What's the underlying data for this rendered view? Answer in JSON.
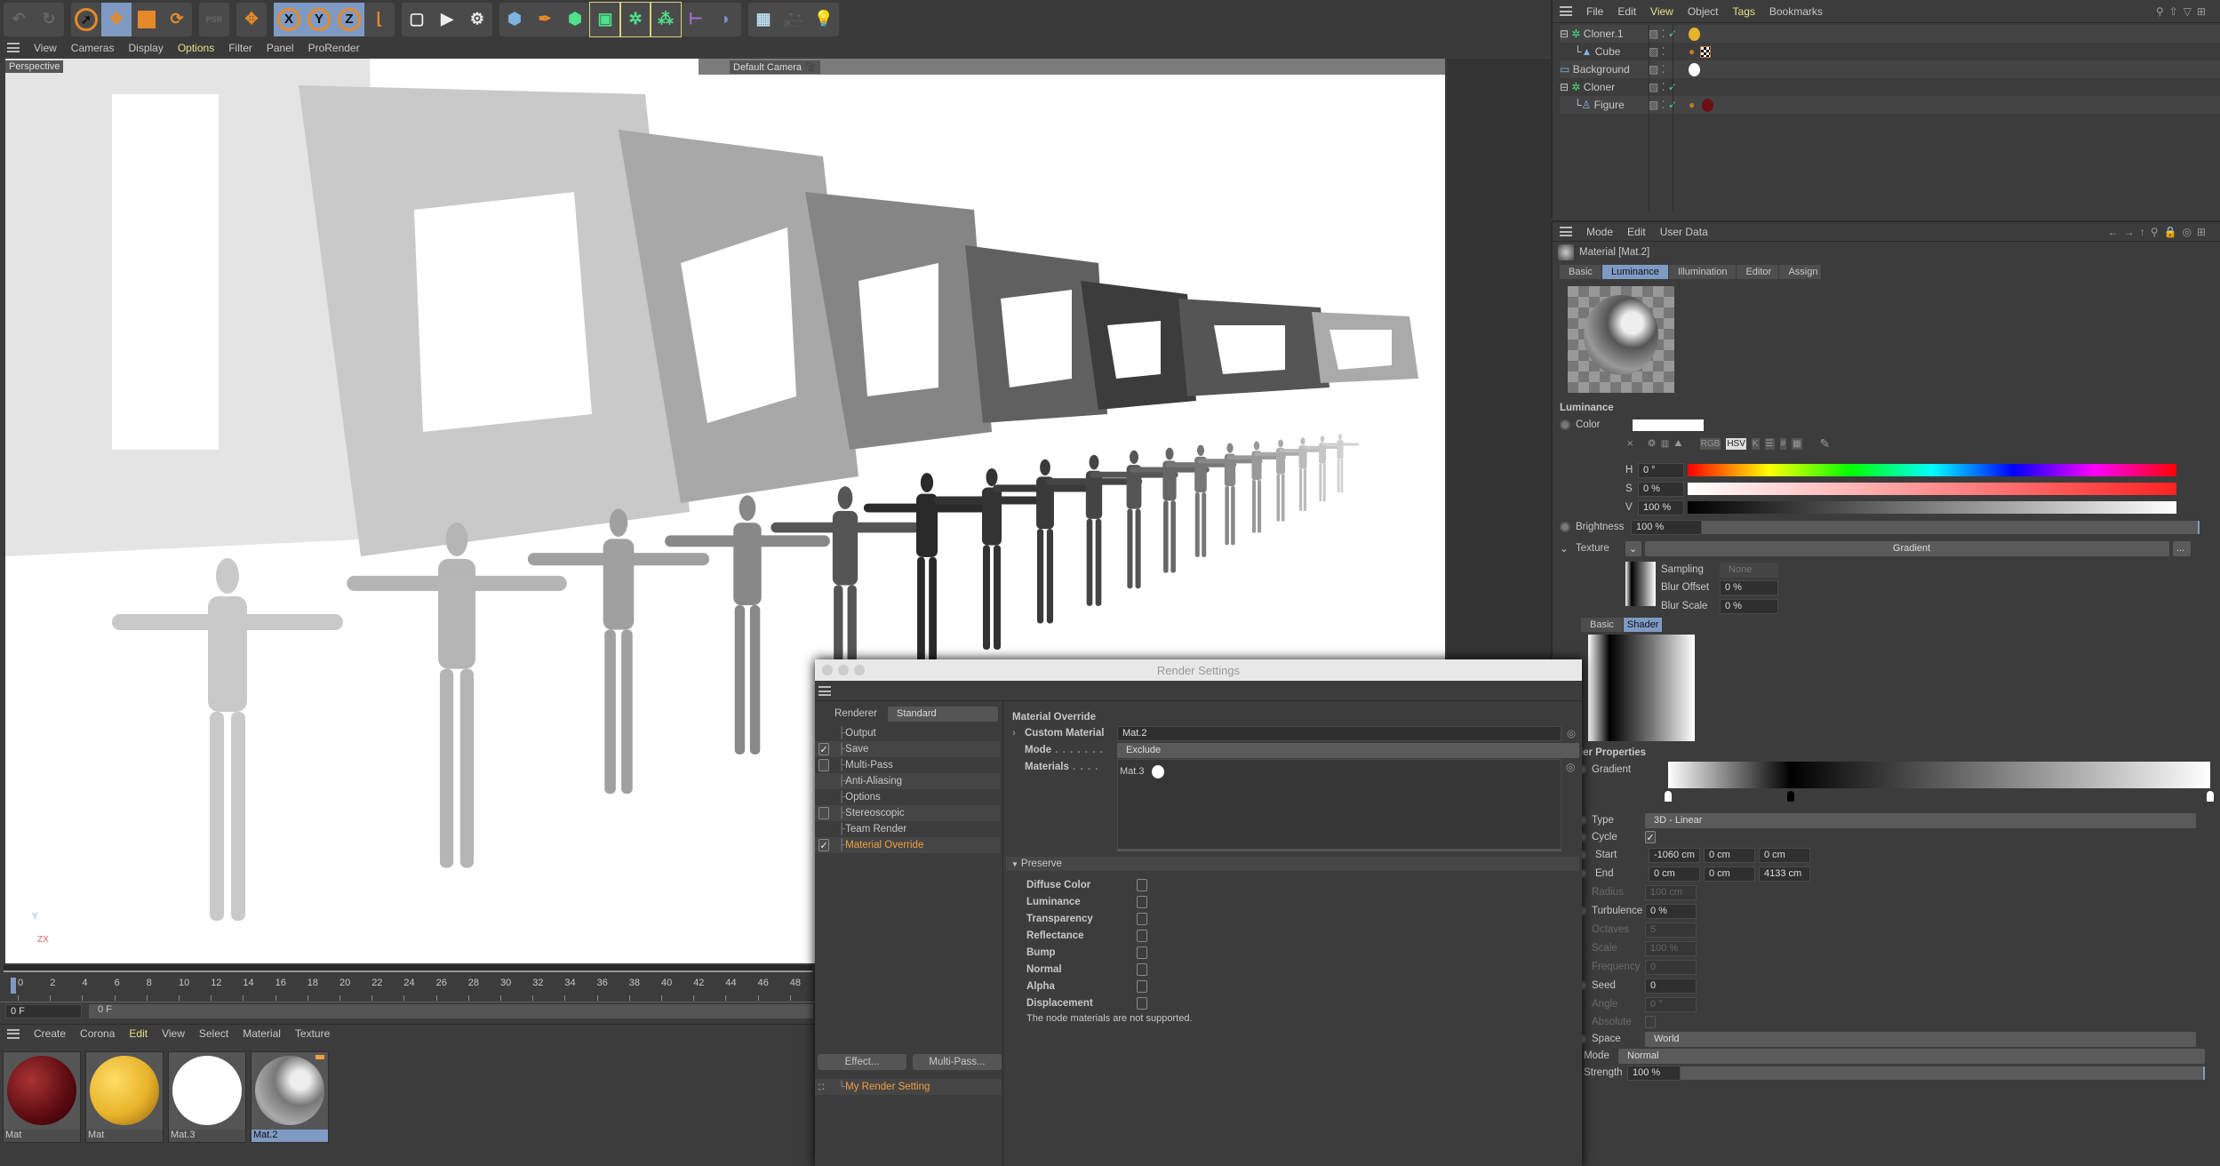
{
  "toolbar": {
    "icons": [
      "undo-icon",
      "redo-icon",
      "live-selection-icon",
      "move-icon",
      "scale-icon",
      "rotate-icon",
      "psr-icon",
      "axis-move-icon",
      "x-axis-lock",
      "y-axis-lock",
      "z-axis-lock",
      "coordinate-system-icon",
      "render-view-icon",
      "render-picture-viewer-icon",
      "render-settings-icon",
      "cube-icon",
      "pen-icon",
      "subdivision-surface-icon",
      "cloner-icon",
      "mograph-icon",
      "voronoi-icon",
      "deformer-icon",
      "field-icon",
      "floor-icon",
      "camera-icon",
      "light-icon"
    ],
    "axis_labels": [
      "X",
      "Y",
      "Z"
    ],
    "psr_label": "PSR"
  },
  "viewport": {
    "menu": [
      "View",
      "Cameras",
      "Display",
      "Options",
      "Filter",
      "Panel",
      "ProRender"
    ],
    "active_menu": "Options",
    "view_name": "Perspective",
    "camera_name": "Default Camera",
    "axis_y": "Y",
    "axis_zx": "ZX"
  },
  "timeline": {
    "ticks": [
      "0",
      "2",
      "4",
      "6",
      "8",
      "10",
      "12",
      "14",
      "16",
      "18",
      "20",
      "22",
      "24",
      "26",
      "28",
      "30",
      "32",
      "34",
      "36",
      "38",
      "40",
      "42",
      "44",
      "46",
      "48"
    ],
    "current_frame": "0 F",
    "end_frame": "0 F"
  },
  "material_manager": {
    "menu": [
      "Create",
      "Corona",
      "Edit",
      "View",
      "Select",
      "Material",
      "Texture"
    ],
    "materials": [
      {
        "name": "Mat",
        "color": "#7a1a1e",
        "selected": false
      },
      {
        "name": "Mat",
        "color": "#e8b32a",
        "selected": false
      },
      {
        "name": "Mat.3",
        "color": "#ffffff",
        "selected": false
      },
      {
        "name": "Mat.2",
        "color": "#9a9a9a",
        "selected": true
      }
    ]
  },
  "object_manager": {
    "menu": [
      "File",
      "Edit",
      "View",
      "Object",
      "Tags",
      "Bookmarks"
    ],
    "objects": [
      {
        "name": "Cloner.1",
        "indent": 0,
        "icon": "cloner-icon",
        "check": true,
        "tags": [
          "material-tag-yellow"
        ]
      },
      {
        "name": "Cube",
        "indent": 1,
        "icon": "cube-icon",
        "check": false,
        "tags": [
          "phong-tag",
          "checker-material-tag"
        ]
      },
      {
        "name": "Background",
        "indent": 0,
        "icon": "background-icon",
        "check": false,
        "tags": [
          "material-tag-white"
        ]
      },
      {
        "name": "Cloner",
        "indent": 0,
        "icon": "cloner-icon",
        "check": true,
        "tags": []
      },
      {
        "name": "Figure",
        "indent": 1,
        "icon": "figure-icon",
        "check": true,
        "tags": [
          "phong-tag",
          "material-tag-red"
        ]
      }
    ]
  },
  "attributes": {
    "menu": [
      "Mode",
      "Edit",
      "User Data"
    ],
    "title": "Material [Mat.2]",
    "tabs": [
      "Basic",
      "Luminance",
      "Illumination",
      "Editor",
      "Assign"
    ],
    "active_tab": "Luminance",
    "section": "Luminance",
    "color_label": "Color",
    "color_value": "#ffffff",
    "color_modes": [
      "RGB",
      "HSV",
      "K",
      "#"
    ],
    "h_label": "H",
    "h_value": "0 °",
    "s_label": "S",
    "s_value": "0 %",
    "v_label": "V",
    "v_value": "100 %",
    "brightness_label": "Brightness",
    "brightness_value": "100 %",
    "brightness_level": 1.0,
    "texture_label": "Texture",
    "texture_value": "Gradient",
    "texture_more": "...",
    "sampling_label": "Sampling",
    "sampling_value": "None",
    "blur_offset_label": "Blur Offset",
    "blur_offset_value": "0 %",
    "blur_scale_label": "Blur Scale",
    "blur_scale_value": "0 %",
    "sub_tabs": [
      "Basic",
      "Shader"
    ],
    "active_sub_tab": "Shader",
    "shader_heading": "Shader Properties",
    "gradient_label": "Gradient",
    "gradient_stops": [
      {
        "pos": 0,
        "color": "#ffffff"
      },
      {
        "pos": 0.226,
        "color": "#000000"
      },
      {
        "pos": 1,
        "color": "#ffffff"
      }
    ],
    "type_label": "Type",
    "type_value": "3D - Linear",
    "cycle_label": "Cycle",
    "cycle_checked": true,
    "start_label": "Start",
    "start_values": [
      "-1060 cm",
      "0 cm",
      "0 cm"
    ],
    "end_label": "End",
    "end_values": [
      "0 cm",
      "0 cm",
      "4133 cm"
    ],
    "radius_label": "Radius",
    "radius_value": "100 cm",
    "turbulence_label": "Turbulence",
    "turbulence_value": "0 %",
    "octaves_label": "Octaves",
    "octaves_value": "5",
    "scale_label": "Scale",
    "scale_value": "100 %",
    "frequency_label": "Frequency",
    "frequency_value": "0",
    "seed_label": "Seed",
    "seed_value": "0",
    "angle_label": "Angle",
    "angle_value": "0 °",
    "absolute_label": "Absolute",
    "absolute_checked": false,
    "space_label": "Space",
    "space_value": "World",
    "mix_mode_label": "Mix Mode",
    "mix_mode_value": "Normal",
    "mix_strength_label": "Mix Strength",
    "mix_strength_value": "100 %"
  },
  "render_settings": {
    "title": "Render Settings",
    "renderer_label": "Renderer",
    "renderer_value": "Standard",
    "items": [
      {
        "label": "Output",
        "checkbox": null
      },
      {
        "label": "Save",
        "checkbox": true
      },
      {
        "label": "Multi-Pass",
        "checkbox": false
      },
      {
        "label": "Anti-Aliasing",
        "checkbox": null
      },
      {
        "label": "Options",
        "checkbox": null
      },
      {
        "label": "Stereoscopic",
        "checkbox": false
      },
      {
        "label": "Team Render",
        "checkbox": null
      },
      {
        "label": "Material Override",
        "checkbox": true
      }
    ],
    "active_item": "Material Override",
    "effect_button": "Effect...",
    "multipass_button": "Multi-Pass...",
    "render_setting_name": "My Render Setting",
    "section_title": "Material Override",
    "custom_material_label": "Custom Material",
    "custom_material_value": "Mat.2",
    "mode_label": "Mode",
    "mode_value": "Exclude",
    "materials_label": "Materials",
    "materials_list": [
      "Mat.3"
    ],
    "preserve_label": "Preserve",
    "preserve": [
      {
        "label": "Diffuse Color",
        "checked": false
      },
      {
        "label": "Luminance",
        "checked": false
      },
      {
        "label": "Transparency",
        "checked": false
      },
      {
        "label": "Reflectance",
        "checked": false
      },
      {
        "label": "Bump",
        "checked": false
      },
      {
        "label": "Normal",
        "checked": false
      },
      {
        "label": "Alpha",
        "checked": false
      },
      {
        "label": "Displacement",
        "checked": false
      }
    ],
    "note": "The node materials are not supported."
  },
  "colors": {
    "accent": "#7f9bc4",
    "highlight": "#f0a040",
    "menu_yellow": "#e5e08a",
    "panel": "#3c3c3c"
  }
}
